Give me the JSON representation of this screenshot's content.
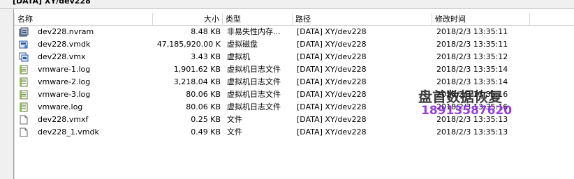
{
  "window": {
    "path_title": "[DATA] XY/dev228"
  },
  "columns": {
    "name": "名称",
    "size": "大小",
    "type": "类型",
    "path": "路径",
    "modified": "修改时间"
  },
  "files": [
    {
      "icon": "nvram-icon",
      "name": "dev228.nvram",
      "size": "8.48 KB",
      "type": "非易失性内存...",
      "path": "[DATA] XY/dev228",
      "modified": "2018/2/3 13:35:11"
    },
    {
      "icon": "virtual-disk-icon",
      "name": "dev228.vmdk",
      "size": "47,185,920.00 K",
      "type": "虚拟磁盘",
      "path": "[DATA] XY/dev228",
      "modified": "2018/2/3 13:35:11"
    },
    {
      "icon": "virtual-machine-icon",
      "name": "dev228.vmx",
      "size": "3.43 KB",
      "type": "虚拟机",
      "path": "[DATA] XY/dev228",
      "modified": "2018/2/3 13:35:12"
    },
    {
      "icon": "log-file-icon",
      "name": "vmware-1.log",
      "size": "1,901.62 KB",
      "type": "虚拟机日志文件",
      "path": "[DATA] XY/dev228",
      "modified": "2018/2/3 13:35:14"
    },
    {
      "icon": "log-file-icon",
      "name": "vmware-2.log",
      "size": "3,218.04 KB",
      "type": "虚拟机日志文件",
      "path": "[DATA] XY/dev228",
      "modified": "2018/2/3 13:35:14"
    },
    {
      "icon": "log-file-icon",
      "name": "vmware-3.log",
      "size": "80.06 KB",
      "type": "虚拟机日志文件",
      "path": "[DATA] XY/dev228",
      "modified": "2018/2/3 13:35:16"
    },
    {
      "icon": "log-file-icon",
      "name": "vmware.log",
      "size": "80.06 KB",
      "type": "虚拟机日志文件",
      "path": "[DATA] XY/dev228",
      "modified": "2018/2/3 13:35:16"
    },
    {
      "icon": "generic-file-icon",
      "name": "dev228.vmxf",
      "size": "0.25 KB",
      "type": "文件",
      "path": "[DATA] XY/dev228",
      "modified": "2018/2/3 13:35:13"
    },
    {
      "icon": "generic-file-icon",
      "name": "dev228_1.vmdk",
      "size": "0.49 KB",
      "type": "文件",
      "path": "[DATA] XY/dev228",
      "modified": "2018/2/3 13:35:13"
    }
  ],
  "watermark": {
    "line1": "盘首数据恢复",
    "line2": "18913587620"
  },
  "colors": {
    "watermark_phone": "#8a2be2",
    "header_border": "#d5d5d5"
  }
}
